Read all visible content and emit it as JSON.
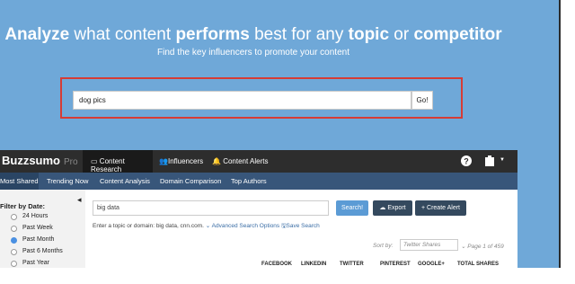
{
  "hero": {
    "headline_parts": [
      {
        "text": "Analyze",
        "bold": true
      },
      {
        "text": " what content ",
        "bold": false
      },
      {
        "text": "performs",
        "bold": true
      },
      {
        "text": " best for any ",
        "bold": false
      },
      {
        "text": "topic",
        "bold": true
      },
      {
        "text": " or ",
        "bold": false
      },
      {
        "text": "competitor",
        "bold": true
      }
    ],
    "subheadline": "Find the key influencers to promote your content",
    "search_value": "dog pics",
    "go_label": "Go!",
    "highlight_color": "#d63c35"
  },
  "app": {
    "logo": "Buzzsumo",
    "logo_badge": "Pro",
    "nav": [
      {
        "label": "Content Research",
        "icon": "laptop-icon",
        "active": true
      },
      {
        "label": "Influencers",
        "icon": "users-icon",
        "active": false
      },
      {
        "label": "Content Alerts",
        "icon": "bell-icon",
        "active": false
      }
    ],
    "subnav": [
      "Most Shared",
      "Trending Now",
      "Content Analysis",
      "Domain Comparison",
      "Top Authors"
    ],
    "filter_title": "Filter by Date:",
    "date_filters": [
      {
        "label": "24 Hours",
        "checked": false
      },
      {
        "label": "Past Week",
        "checked": false
      },
      {
        "label": "Past Month",
        "checked": true
      },
      {
        "label": "Past 6 Months",
        "checked": false
      },
      {
        "label": "Past Year",
        "checked": false
      }
    ],
    "search_value": "big data",
    "search_button": "Search!",
    "export_button": "Export",
    "alert_button": "+ Create Alert",
    "helper_text": "Enter a topic or domain: big data, cnn.com.",
    "advanced_link": "Advanced Search Options",
    "save_link": "Save Search",
    "sort_label": "Sort by:",
    "sort_value": "Twitter Shares",
    "pager": "Page 1 of 459",
    "columns": [
      "FACEBOOK",
      "LINKEDIN",
      "TWITTER",
      "PINTEREST",
      "GOOGLE+",
      "TOTAL SHARES"
    ],
    "colors": {
      "topbar": "#2d2d2d",
      "subnav": "#38567a",
      "search_btn": "#5b9bd5",
      "dark_btn": "#34495e"
    }
  }
}
